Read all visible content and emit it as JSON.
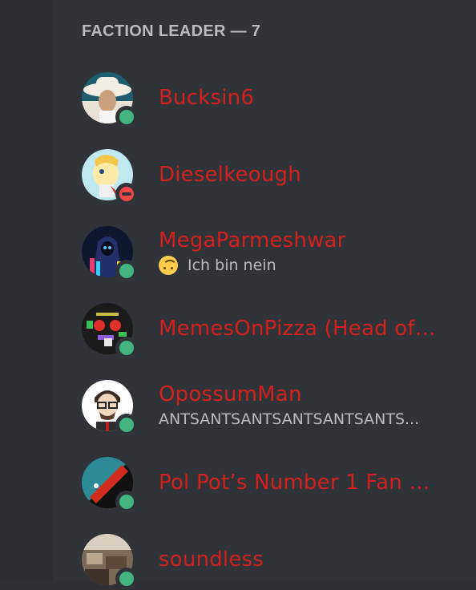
{
  "section": {
    "title": "FACTION LEADER — 7"
  },
  "members": [
    {
      "name": "Bucksin6",
      "status": "online",
      "activity": null,
      "avatar": "cowboy-hat-person"
    },
    {
      "name": "Dieselkeough",
      "status": "dnd",
      "activity": null,
      "avatar": "pony-character"
    },
    {
      "name": "MegaParmeshwar",
      "status": "online",
      "activity": "Ich bin nein",
      "activity_emoji": "upside-down-face",
      "avatar": "hooded-figure"
    },
    {
      "name": "MemesOnPizza (Head of O...",
      "status": "online",
      "activity": null,
      "avatar": "pixel-art"
    },
    {
      "name": "OpossumMan",
      "status": "online",
      "activity": "ANTSANTSANTSANTSANTSANTS...",
      "avatar": "cartoon-man-glasses"
    },
    {
      "name": "Pol Pot’s Number 1 Fan (UT...",
      "status": "online",
      "activity": null,
      "avatar": "red-black-flag"
    },
    {
      "name": "soundless",
      "status": "online",
      "activity": null,
      "avatar": "room-photo"
    }
  ],
  "colors": {
    "role": "#d1201f",
    "online": "#43b581",
    "dnd": "#f04747",
    "background": "#303338"
  }
}
